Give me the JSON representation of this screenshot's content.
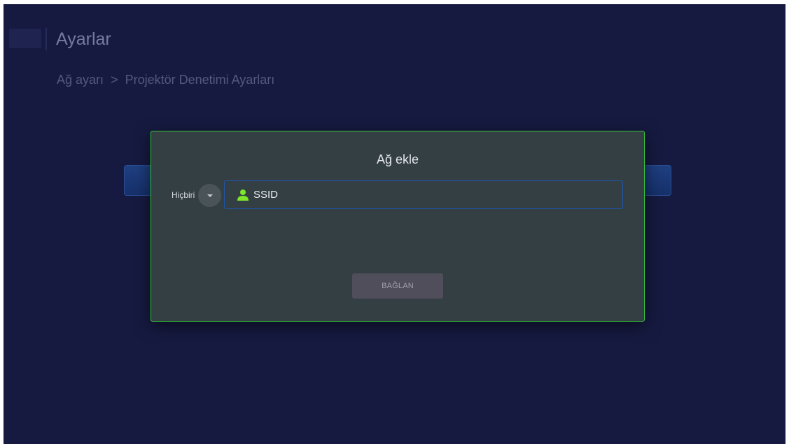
{
  "header": {
    "title": "Ayarlar",
    "breadcrumb": {
      "parent": "Ağ ayarı",
      "separator": ">",
      "current": "Projektör Denetimi Ayarları"
    }
  },
  "dialog": {
    "title": "Ağ ekle",
    "security": {
      "selected": "Hiçbiri",
      "dropdown_icon": "chevron-down-icon"
    },
    "ssid": {
      "placeholder": "SSID",
      "value": "",
      "icon": "user-icon"
    },
    "connect_label": "BAĞLAN"
  },
  "colors": {
    "background": "#161a40",
    "dialog_background": "#343f44",
    "dialog_border": "#37c63c",
    "field_border": "#1f55a8",
    "icon_accent": "#7ee62a",
    "button_background": "#514e5b"
  }
}
